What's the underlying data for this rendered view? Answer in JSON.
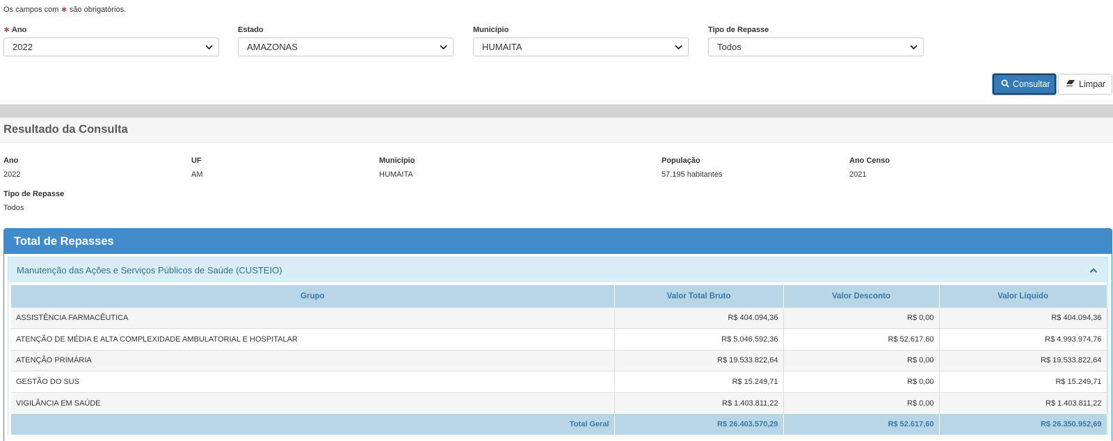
{
  "form": {
    "note_prefix": "Os campos com",
    "note_star": "∗",
    "note_suffix": "são obrigatórios.",
    "fields": [
      {
        "label": "Ano",
        "required_star": "∗",
        "value": "2022"
      },
      {
        "label": "Estado",
        "value": "AMAZONAS"
      },
      {
        "label": "Município",
        "value": "HUMAITA"
      },
      {
        "label": "Tipo de Repasse",
        "value": "Todos"
      }
    ],
    "consultar_label": "Consultar",
    "limpar_label": "Limpar"
  },
  "result": {
    "title": "Resultado da Consulta",
    "info": [
      {
        "label": "Ano",
        "value": "2022"
      },
      {
        "label": "UF",
        "value": "AM"
      },
      {
        "label": "Município",
        "value": "HUMAITA"
      },
      {
        "label": "População",
        "value": "57.195 habitantes"
      },
      {
        "label": "Ano Censo",
        "value": "2021"
      },
      {
        "label": "Tipo de Repasse",
        "value": "Todos"
      }
    ]
  },
  "panel": {
    "title": "Total de Repasses",
    "section_title": "Manutenção das Ações e Serviços Públicos de Saúde (CUSTEIO)",
    "table": {
      "headers": [
        "Grupo",
        "Valor Total Bruto",
        "Valor Desconto",
        "Valor Líquido"
      ],
      "rows": [
        [
          "ASSISTÊNCIA FARMACÊUTICA",
          "R$ 404.094,36",
          "R$ 0,00",
          "R$ 404.094,36"
        ],
        [
          "ATENÇÃO DE MÉDIA E ALTA COMPLEXIDADE AMBULATORIAL E HOSPITALAR",
          "R$ 5.046.592,36",
          "R$ 52.617,60",
          "R$ 4.993.974,76"
        ],
        [
          "ATENÇÃO PRIMÁRIA",
          "R$ 19.533.822,64",
          "R$ 0,00",
          "R$ 19.533.822,64"
        ],
        [
          "GESTÃO DO SUS",
          "R$ 15.249,71",
          "R$ 0,00",
          "R$ 15.249,71"
        ],
        [
          "VIGILÂNCIA EM SAÚDE",
          "R$ 1.403.811,22",
          "R$ 0,00",
          "R$ 1.403.811,22"
        ]
      ],
      "total": [
        "Total Geral",
        "R$ 26.403.570,29",
        "R$ 52.617,60",
        "R$ 26.350.952,69"
      ]
    }
  },
  "colors": {
    "primary": "#337ab7",
    "panel_heading": "#428bca",
    "sub_heading_bg": "#d9edf7",
    "table_header_bg": "#b9d6e6",
    "required": "#a94442"
  },
  "icons": {
    "select_arrow": "chevron-down-icon",
    "consultar": "search-icon",
    "limpar": "eraser-icon",
    "collapse": "chevron-up-icon"
  }
}
